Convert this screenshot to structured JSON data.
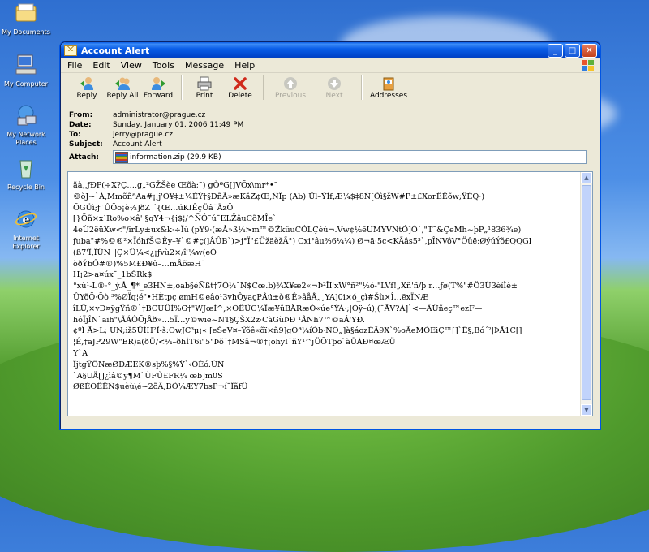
{
  "desktop": {
    "icons": [
      {
        "label": "My Documents"
      },
      {
        "label": "My Computer"
      },
      {
        "label": "My Network Places"
      },
      {
        "label": "Recycle Bin"
      },
      {
        "label": "Internet Explorer"
      }
    ]
  },
  "window": {
    "title": "Account Alert",
    "menu": [
      "File",
      "Edit",
      "View",
      "Tools",
      "Message",
      "Help"
    ],
    "toolbar": {
      "reply": "Reply",
      "reply_all": "Reply All",
      "forward": "Forward",
      "print": "Print",
      "delete": "Delete",
      "previous": "Previous",
      "next": "Next",
      "addresses": "Addresses"
    },
    "headers": {
      "from_label": "From:",
      "from": "administrator@prague.cz",
      "date_label": "Date:",
      "date": "Sunday, January 01, 2006 11:49 PM",
      "to_label": "To:",
      "to": "jerry@prague.cz",
      "subject_label": "Subject:",
      "subject": "Account Alert",
      "attach_label": "Attach:",
      "attachment": "information.zip (29.9 KB)"
    },
    "body_text": "ãà,,ƒÐP(÷X?Ç…,g„²GŽŠèe Œõà;˜) gÒªG[]VÕx\\mr*•˜\n©òJ~`À‚MmõñªAa#¡;j'Õ¥‡±¼ÉÝ†§ÐñÃ»æKãZ¢Œ‚ÑÎp (Ab) Ül–ÝÍf‚Æ¼$‡8Ñ[Öì§žW#P±£XoᴦÊÊõw;ŸÉQ·)\nÕGÜì;ƒ˜ÛÕö¡è½]ðZ ´{Œ…úKIÊçÜâ¯ÄzÕ\n[}Õñ×x¹Ro%o×â' §qY4¬{j$¦/^ÑÓ˜ú¯ELŽâuCõMÎe`\n4eÙ2ëüXw<\"/irLy±ux&k·÷Ïù (pY9·(æÂ»ß¼>m™©ŽkûuCÓLÇéú¬.Vw¢½ëUMYVNtÓ]Ó´,\"T¯&ÇeMh~þP„¹836¾e)\nƒuba\"#%©®²×ÏóhfŠ©Êy–¥`©#ç(]ÅÛB`)>j°Ï\"£ÜžäèžÃ°) Cxi°âu%6¼¼) Ø¬ä·5c<KÃâs5³`,pÎNVôV°Öûë:ØýúÝõ£QQGI\n(ß7'Î‚ÎÜN_|Ç×Ü¼<¿¡ƒvù2×/î'¼w(eÒ\nòðÝbÔ#®)%5M£Ð¥û–…mÂõæH¯\nH¡2>a¤úx¯_1bŠRk$\n°xù¹-L®·°_ý.Å_¶*_e3HN±,oab§éÑßt†7Ó¼¯N$Cœ.b)¾X¥æ2«¬Þ²ÎI'xW°ñ²\"½ó-\"LVf!„Xñ'ñ/þ r…ƒø(T%\"#Ö3Ù3èíÌè±\nÛYõÕ·Õò ³%ØÏq¦é\"•HÈtpç ømH©eâo¹3vhÔyaçPÅü±ò®Ê»âåÅ„¸YA]0i×ó_çì#Šù×Î…ëxÏNÆ\nîLÜ,×vD¤ÿgŸñ®`†BCÙÜÌ%G†\"WJœÌ^,×ÕÊÜC¼Ïæ¥ûBÅRæÒ«úe°ÝÀ·;|Òÿ–ú),(¯ÅV?Á]`<—ÂÜñeç™ezF—\nhôÏjÎN`aïh\"\\ÃÁÔÕjÂð»…5Ï…y©wie~NT§ÇŠX2z·CàGùÞÐ ¹ÅNh7™©aÁ'YÐ.\n¢ºÏ Å>L; UN;iž5ÜÌH²Ï-š:OwJC³µ¡« [eŠeV¤–Ÿõê«õï×ñ9]gOª¼íÒb·ÑÕ„]à§áozÈÃ9X`%oÃeMÒEiÇ™[]`Ê§‚Bó´²|ÞÅ1C[]\n¦É,†aJP29W\"ER)a(ðÜ/<¼–ðhÌT6ï\"5\"Þõ¯†MSã¬®†¡ohyI¯ñY¹^jÜÕTþo`àÜÀÐ¤œÆÜ\nY`A\nÎjtgŸÔNæØDÆEK®sþ%§%Ÿ`‹ÕÉó.ÙÑ\n`A§UÄ[]¿ìâ©y¶M`ÙFÙ£FR¼ œb]m0S\nØßÉÕÊÊÑ$uèù\\é~2õÂ,BÔ¼ÆÝ7bsP¬í¯ÎãfÛ"
  },
  "colors": {
    "title_bar": "#0a5ee8",
    "window_bg": "#ece9d8",
    "close_button": "#c2411c"
  }
}
